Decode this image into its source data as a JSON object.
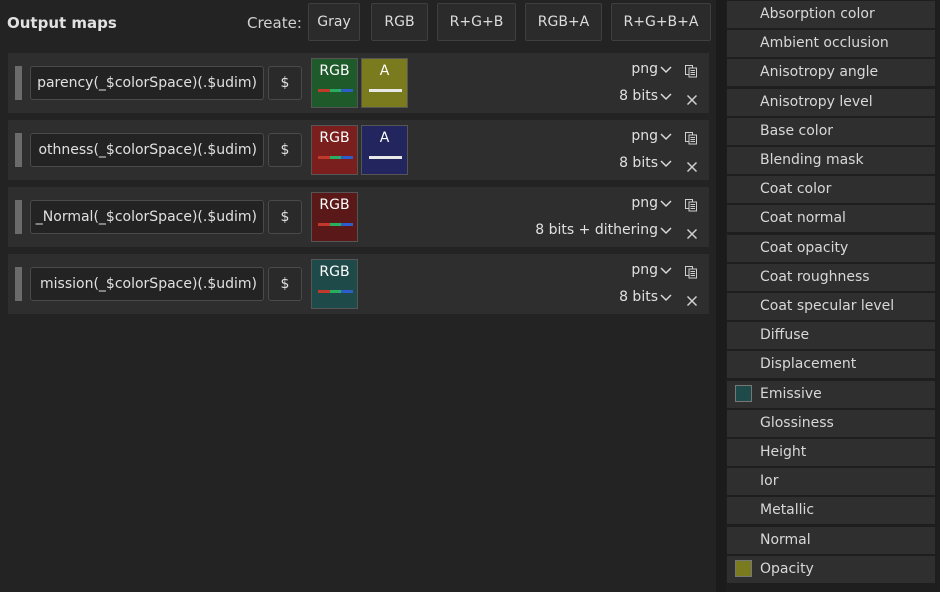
{
  "output_maps": {
    "title": "Output maps",
    "create_label": "Create:",
    "create_buttons": [
      "Gray",
      "RGB",
      "R+G+B",
      "RGB+A",
      "R+G+B+A"
    ],
    "rows": [
      {
        "pattern": "parency(_$colorSpace)(.$udim)",
        "dollar": "$",
        "swatches": [
          {
            "label": "RGB",
            "kind": "rgb",
            "color": "#1f5a2a"
          },
          {
            "label": "A",
            "kind": "a",
            "color": "#7a7a1f"
          }
        ],
        "format": "png",
        "bits": "8 bits"
      },
      {
        "pattern": "othness(_$colorSpace)(.$udim)",
        "dollar": "$",
        "swatches": [
          {
            "label": "RGB",
            "kind": "rgb",
            "color": "#7a1e1e"
          },
          {
            "label": "A",
            "kind": "a",
            "color": "#22255e"
          }
        ],
        "format": "png",
        "bits": "8 bits"
      },
      {
        "pattern": "_Normal(_$colorSpace)(.$udim)",
        "dollar": "$",
        "swatches": [
          {
            "label": "RGB",
            "kind": "rgb",
            "color": "#5a1818"
          }
        ],
        "format": "png",
        "bits": "8 bits + dithering"
      },
      {
        "pattern": "mission(_$colorSpace)(.$udim)",
        "dollar": "$",
        "swatches": [
          {
            "label": "RGB",
            "kind": "rgb",
            "color": "#1f4a4a"
          }
        ],
        "format": "png",
        "bits": "8 bits"
      }
    ]
  },
  "channels": [
    {
      "label": "Absorption color"
    },
    {
      "label": "Ambient occlusion"
    },
    {
      "label": "Anisotropy angle"
    },
    {
      "label": "Anisotropy level"
    },
    {
      "label": "Base color"
    },
    {
      "label": "Blending mask"
    },
    {
      "label": "Coat color"
    },
    {
      "label": "Coat normal"
    },
    {
      "label": "Coat opacity"
    },
    {
      "label": "Coat roughness"
    },
    {
      "label": "Coat specular level"
    },
    {
      "label": "Diffuse"
    },
    {
      "label": "Displacement"
    },
    {
      "label": "Emissive",
      "swatch": "#1f4a4a"
    },
    {
      "label": "Glossiness"
    },
    {
      "label": "Height"
    },
    {
      "label": "Ior"
    },
    {
      "label": "Metallic"
    },
    {
      "label": "Normal"
    },
    {
      "label": "Opacity",
      "swatch": "#7a7a1f"
    }
  ],
  "colors": {
    "rgb_bar": [
      "#c0392b",
      "#27ae60",
      "#2e5cc9"
    ]
  }
}
